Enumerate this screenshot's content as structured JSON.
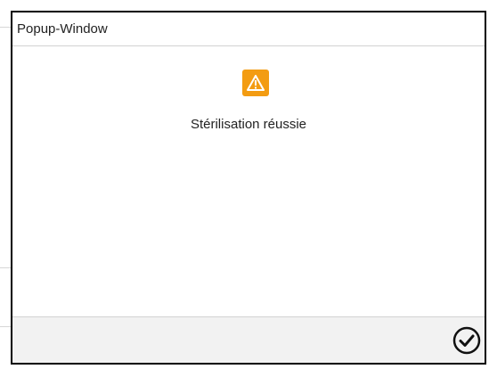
{
  "popup": {
    "title": "Popup-Window",
    "message": "Stérilisation réussie",
    "icon": "warning-icon",
    "confirm_icon": "checkmark-circle-icon"
  },
  "colors": {
    "warning": "#f39c12",
    "border": "#000000",
    "footer_bg": "#f2f2f2"
  }
}
